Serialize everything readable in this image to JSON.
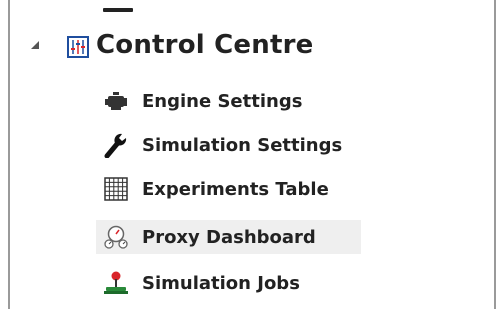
{
  "tree": {
    "root": {
      "label": "Control Centre",
      "icon": "equalizer-icon",
      "expanded": true
    },
    "items": [
      {
        "label": "Engine Settings",
        "icon": "engine-icon",
        "selected": false
      },
      {
        "label": "Simulation Settings",
        "icon": "wrench-icon",
        "selected": false
      },
      {
        "label": "Experiments Table",
        "icon": "grid-table-icon",
        "selected": false
      },
      {
        "label": "Proxy Dashboard",
        "icon": "gauges-icon",
        "selected": true
      },
      {
        "label": "Simulation Jobs",
        "icon": "joystick-icon",
        "selected": false
      }
    ]
  },
  "colors": {
    "selection_bg": "#efefef",
    "root_icon_blue": "#1f4e9e",
    "icon_red": "#d9252a"
  }
}
